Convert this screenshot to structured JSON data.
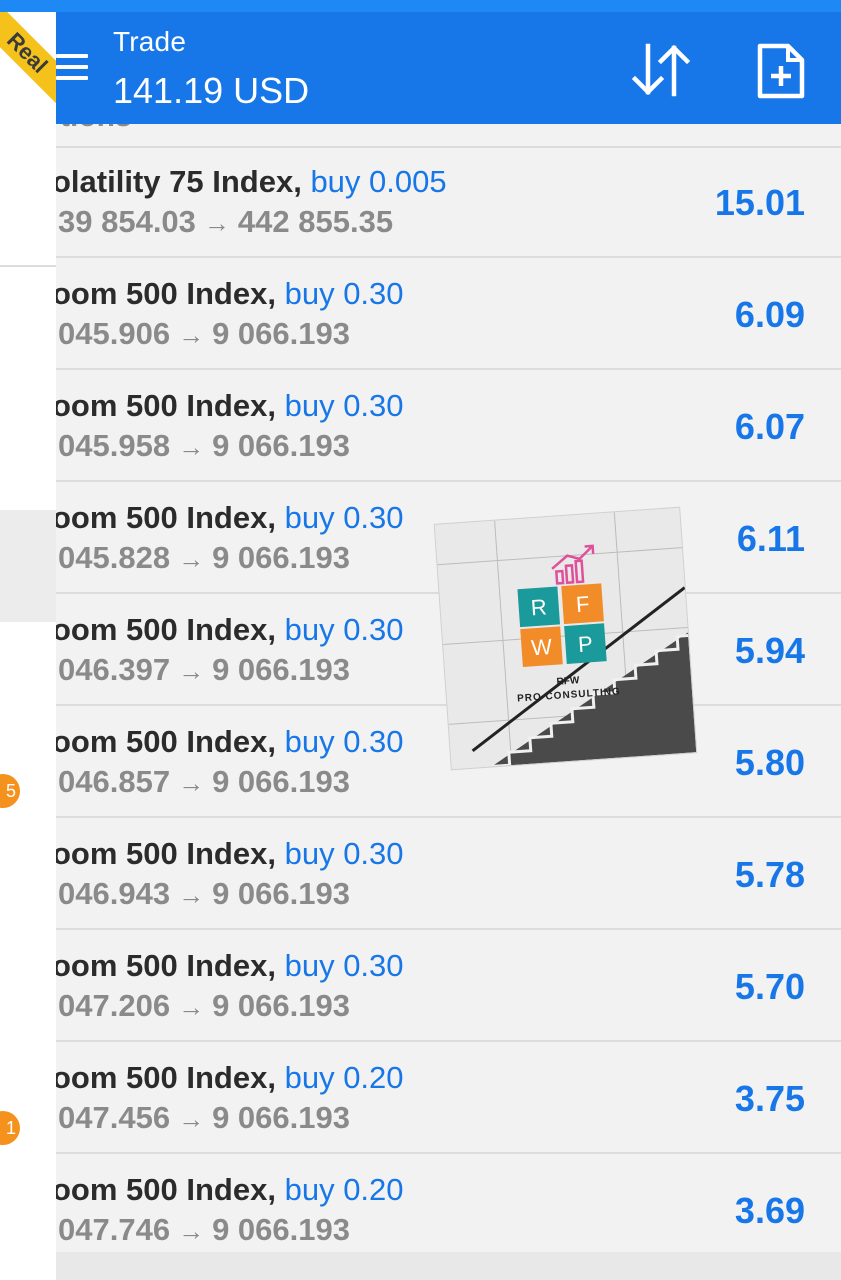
{
  "header": {
    "title": "Trade",
    "balance": "141.19 USD"
  },
  "drawer": {
    "account_badge": "Real",
    "badges": [
      "5",
      "1"
    ]
  },
  "list": {
    "cut_off_row": "tions",
    "rows": [
      {
        "symbol": "olatility 75 Index,",
        "side": "buy 0.005",
        "open": "39 854.03",
        "current": "442 855.35",
        "profit": "15.01"
      },
      {
        "symbol": "oom 500 Index,",
        "side": "buy 0.30",
        "open": "045.906",
        "current": "9 066.193",
        "profit": "6.09"
      },
      {
        "symbol": "oom 500 Index,",
        "side": "buy 0.30",
        "open": "045.958",
        "current": "9 066.193",
        "profit": "6.07"
      },
      {
        "symbol": "oom 500 Index,",
        "side": "buy 0.30",
        "open": "045.828",
        "current": "9 066.193",
        "profit": "6.11"
      },
      {
        "symbol": "oom 500 Index,",
        "side": "buy 0.30",
        "open": "046.397",
        "current": "9 066.193",
        "profit": "5.94"
      },
      {
        "symbol": "oom 500 Index,",
        "side": "buy 0.30",
        "open": "046.857",
        "current": "9 066.193",
        "profit": "5.80"
      },
      {
        "symbol": "oom 500 Index,",
        "side": "buy 0.30",
        "open": "046.943",
        "current": "9 066.193",
        "profit": "5.78"
      },
      {
        "symbol": "oom 500 Index,",
        "side": "buy 0.30",
        "open": "047.206",
        "current": "9 066.193",
        "profit": "5.70"
      },
      {
        "symbol": "oom 500 Index,",
        "side": "buy 0.20",
        "open": "047.456",
        "current": "9 066.193",
        "profit": "3.75"
      },
      {
        "symbol": "oom 500 Index,",
        "side": "buy 0.20",
        "open": "047.746",
        "current": "9 066.193",
        "profit": "3.69"
      }
    ]
  },
  "watermark": {
    "letters": [
      "R",
      "F",
      "W",
      "P"
    ],
    "text_line1": "RFW",
    "text_line2": "PRO CONSULTING"
  },
  "colors": {
    "header_bg": "#1777e8",
    "accent_blue": "#1777e8",
    "badge_orange": "#f5921e",
    "ribbon_yellow": "#f4c21b",
    "teal": "#1a9a9a",
    "orange": "#f28c28",
    "pink": "#e0509a"
  },
  "icons": [
    "menu-icon",
    "sort-icon",
    "new-order-icon",
    "arrow-right-icon"
  ]
}
